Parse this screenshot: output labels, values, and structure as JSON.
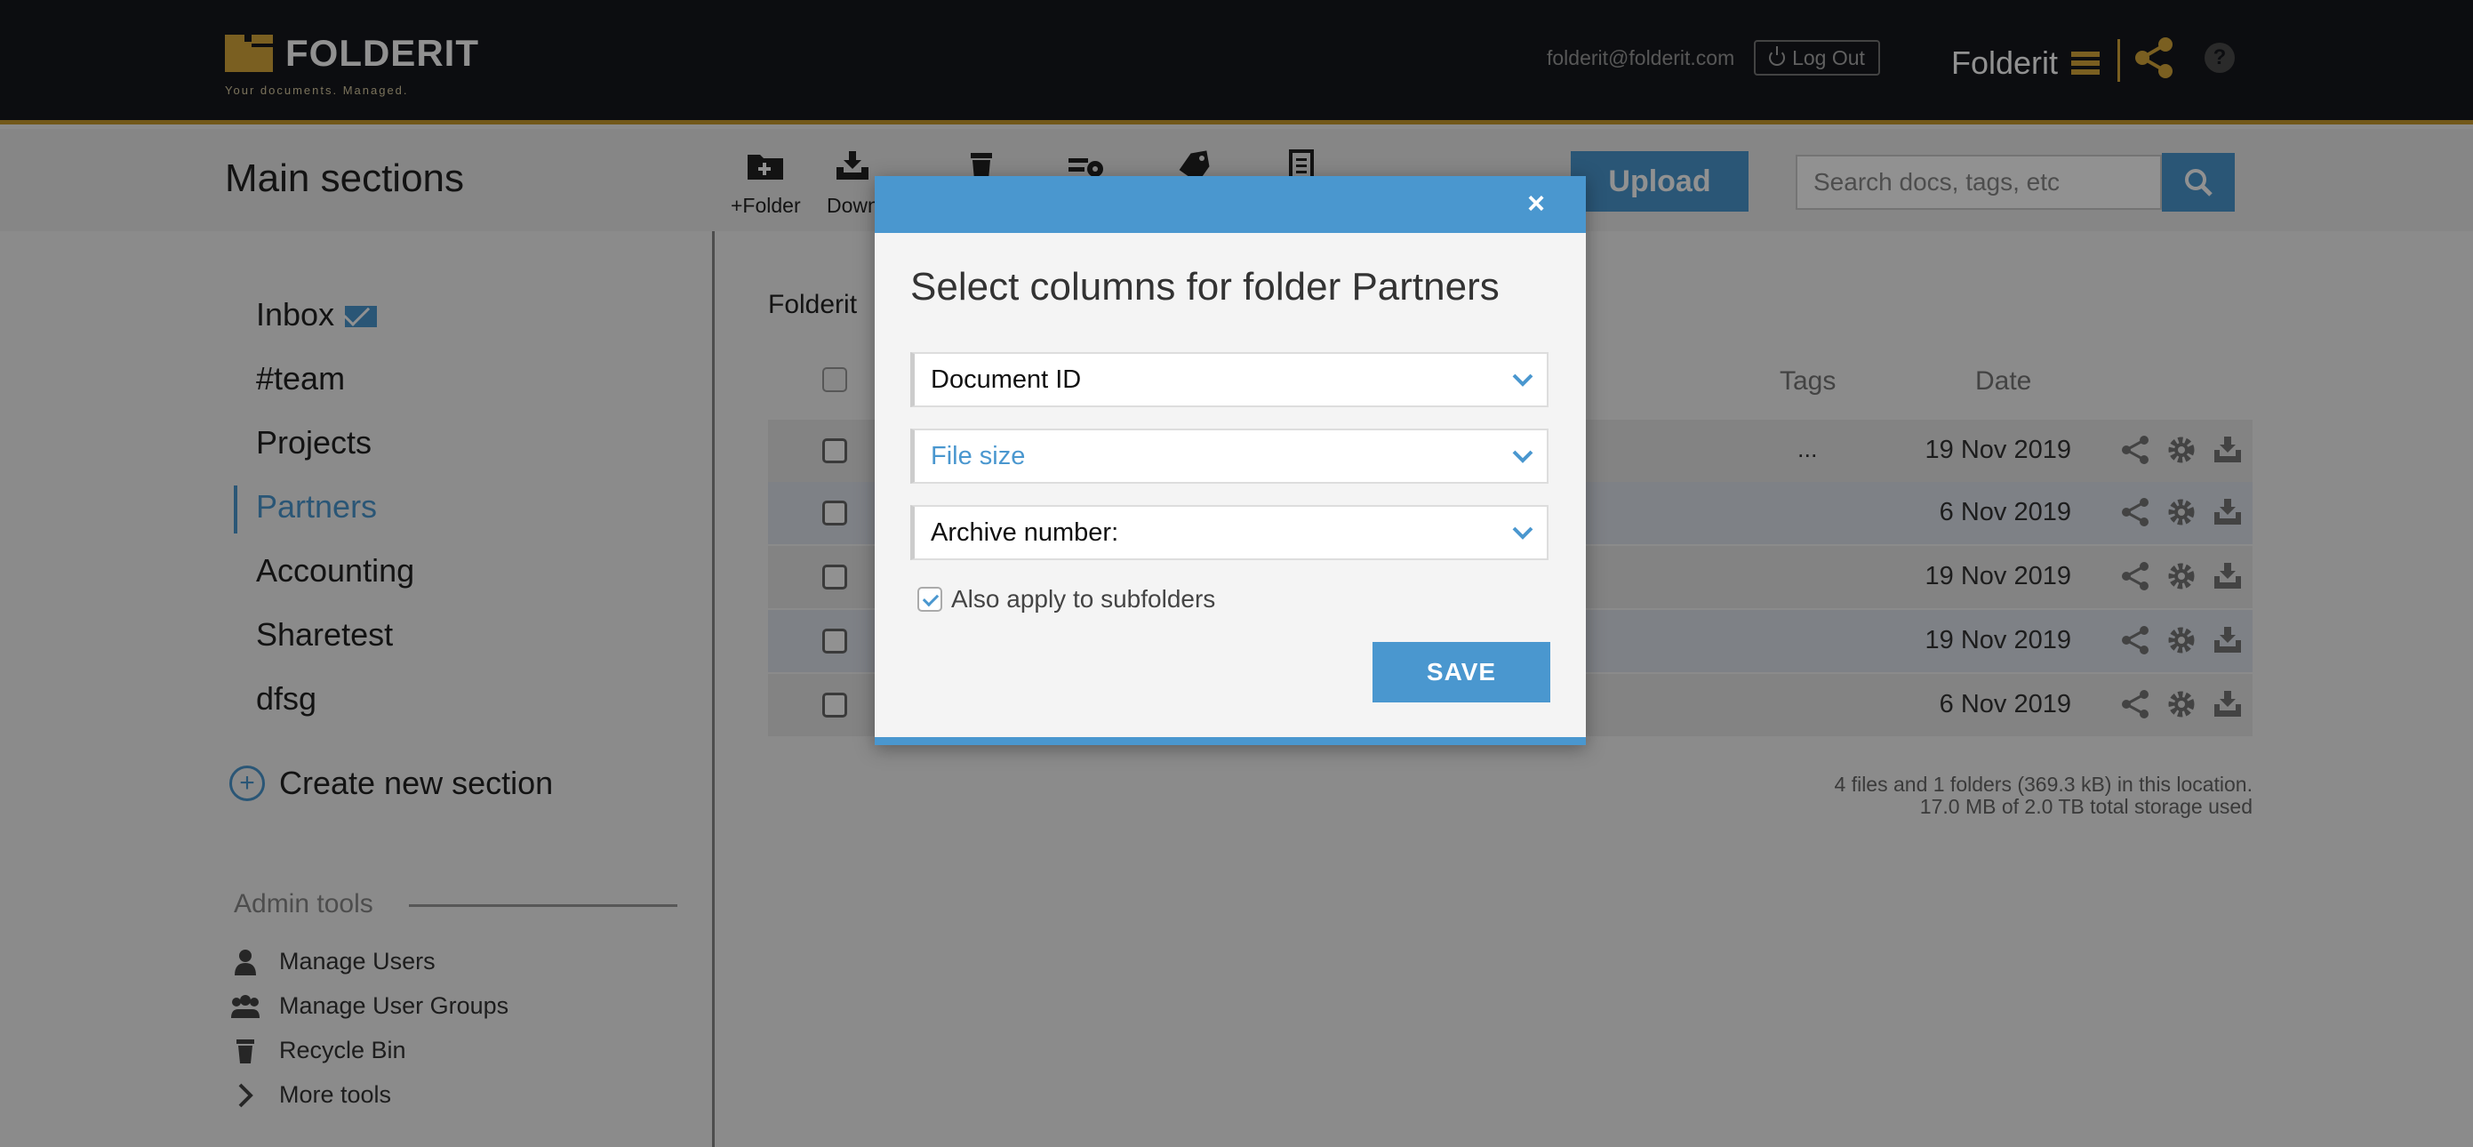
{
  "topbar": {
    "logo_text": "FOLDERIT",
    "logo_tagline": "Your documents. Managed.",
    "user_email": "folderit@folderit.com",
    "logout_label": "Log Out",
    "brand_name": "Folderit",
    "help_label": "?"
  },
  "header": {
    "title": "Main sections",
    "toolbar": [
      {
        "label": "+Folder",
        "icon": "folder-plus-icon"
      },
      {
        "label": "Down",
        "icon": "download-icon"
      },
      {
        "label": "",
        "icon": "trash-icon"
      },
      {
        "label": "",
        "icon": "edit-settings-icon"
      },
      {
        "label": "",
        "icon": "tag-icon"
      },
      {
        "label": "",
        "icon": "document-icon"
      }
    ],
    "upload_label": "Upload",
    "search_placeholder": "Search docs, tags, etc"
  },
  "sidebar": {
    "items": [
      {
        "label": "Inbox"
      },
      {
        "label": "#team"
      },
      {
        "label": "Projects"
      },
      {
        "label": "Partners",
        "active": true
      },
      {
        "label": "Accounting"
      },
      {
        "label": "Sharetest"
      },
      {
        "label": "dfsg"
      }
    ],
    "create_label": "Create new section",
    "admin_title": "Admin tools",
    "admin_items": [
      {
        "label": "Manage Users",
        "icon": "user-icon"
      },
      {
        "label": "Manage User Groups",
        "icon": "users-group-icon"
      },
      {
        "label": "Recycle Bin",
        "icon": "trash-icon"
      },
      {
        "label": "More tools",
        "icon": "chevron-right-icon"
      }
    ]
  },
  "main": {
    "breadcrumb": "Folderit",
    "columns": {
      "tags": "Tags",
      "date": "Date"
    },
    "rows": [
      {
        "tags": "...",
        "date": "19 Nov 2019"
      },
      {
        "tags": "",
        "date": "6 Nov 2019"
      },
      {
        "tags": "",
        "date": "19 Nov 2019"
      },
      {
        "tags": "",
        "date": "19 Nov 2019"
      },
      {
        "tags": "",
        "date": "6 Nov 2019"
      }
    ],
    "footer_line1": "4 files and 1 folders (369.3 kB) in this location.",
    "footer_line2": "17.0 MB of 2.0 TB total storage used"
  },
  "modal": {
    "close_label": "×",
    "title": "Select columns for folder Partners",
    "selects": [
      {
        "value": "Document ID"
      },
      {
        "value": "File size"
      },
      {
        "value": "Archive number:"
      }
    ],
    "apply_label": "Also apply to subfolders",
    "apply_checked": true,
    "save_label": "SAVE"
  },
  "colors": {
    "accent_blue": "#4a97cf",
    "brand_gold": "#d6a83a",
    "topbar_bg": "#16181d"
  }
}
